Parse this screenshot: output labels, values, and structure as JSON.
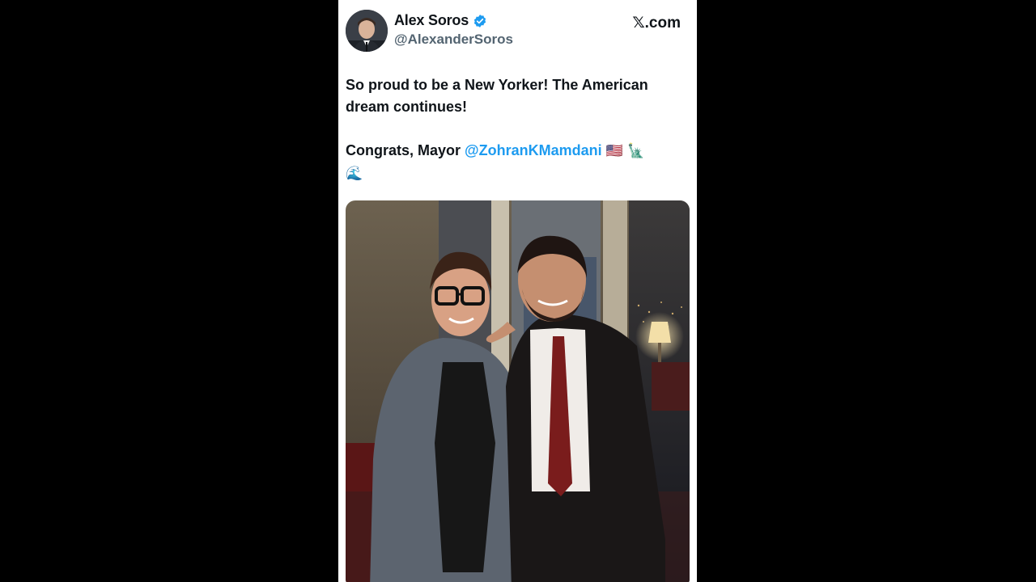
{
  "post": {
    "author": {
      "display_name": "Alex Soros",
      "handle": "@AlexanderSoros",
      "verified": true
    },
    "brand_label": "𝕏.com",
    "text": {
      "line1": "So proud to be a New Yorker! The American dream continues!",
      "congrats_prefix": " Congrats, Mayor ",
      "mention": "@ZohranKMamdani",
      "emojis_inline": "🇺🇸 🗽",
      "emojis_wrap": "🌊"
    },
    "media": {
      "type": "photo",
      "description_icon": "photo-icon"
    }
  },
  "colors": {
    "background": "#000000",
    "card": "#ffffff",
    "text_primary": "#0f1419",
    "text_secondary": "#536471",
    "accent": "#1d9bf0"
  }
}
